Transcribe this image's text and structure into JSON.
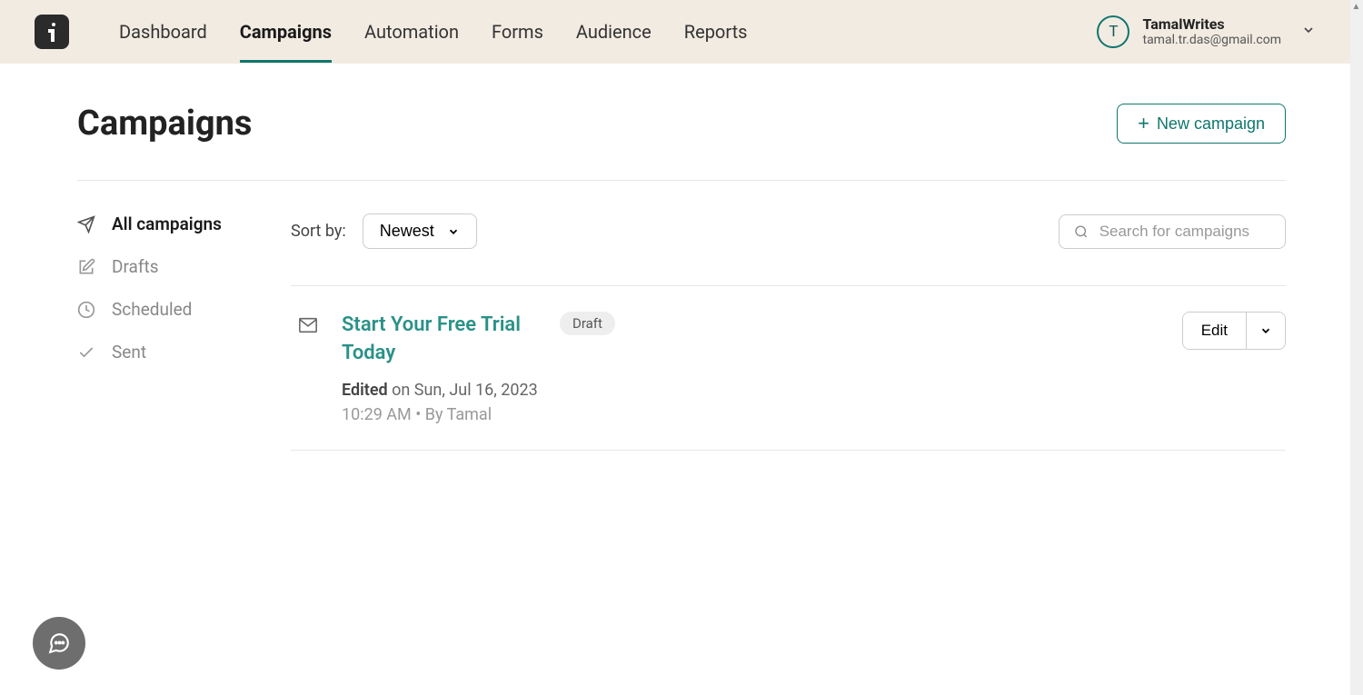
{
  "nav": {
    "items": [
      "Dashboard",
      "Campaigns",
      "Automation",
      "Forms",
      "Audience",
      "Reports"
    ],
    "active": "Campaigns"
  },
  "user": {
    "initial": "T",
    "name": "TamalWrites",
    "email": "tamal.tr.das@gmail.com"
  },
  "page": {
    "title": "Campaigns",
    "new_button": "New campaign"
  },
  "sidebar": {
    "items": [
      {
        "label": "All campaigns",
        "active": true,
        "icon": "send"
      },
      {
        "label": "Drafts",
        "active": false,
        "icon": "edit"
      },
      {
        "label": "Scheduled",
        "active": false,
        "icon": "clock"
      },
      {
        "label": "Sent",
        "active": false,
        "icon": "check"
      }
    ]
  },
  "sort": {
    "label": "Sort by:",
    "value": "Newest"
  },
  "search": {
    "placeholder": "Search for campaigns"
  },
  "campaigns": [
    {
      "title": "Start Your Free Trial Today",
      "badge": "Draft",
      "edited_prefix": "Edited",
      "edited_date": "on Sun, Jul 16, 2023",
      "meta": "10:29 AM • By Tamal",
      "edit_label": "Edit"
    }
  ]
}
